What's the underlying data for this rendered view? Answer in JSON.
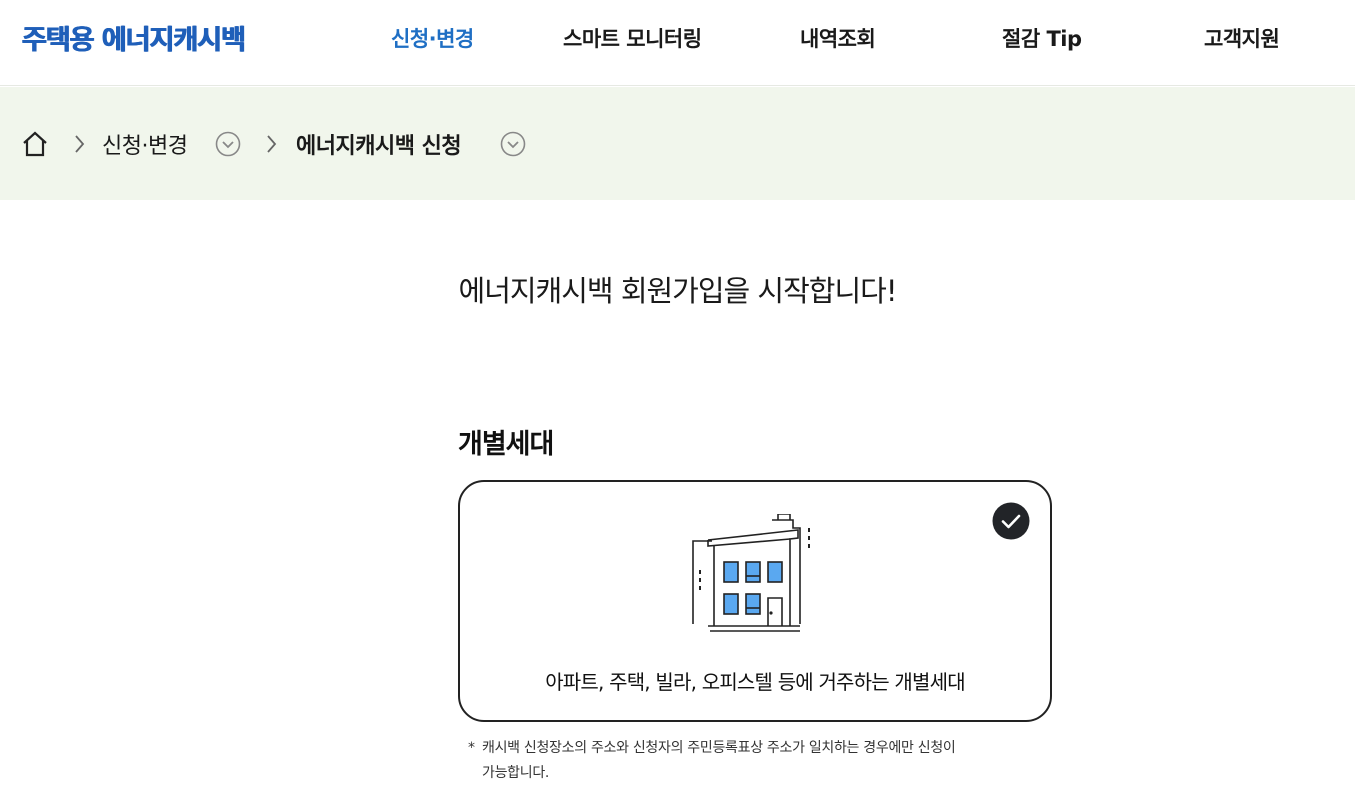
{
  "header": {
    "logo": "주택용 에너지캐시백",
    "nav": [
      {
        "label": "신청·변경",
        "active": true
      },
      {
        "label": "스마트 모니터링",
        "active": false
      },
      {
        "label": "내역조회",
        "active": false
      },
      {
        "label": "절감 Tip",
        "active": false
      },
      {
        "label": "고객지원",
        "active": false
      }
    ]
  },
  "breadcrumb": {
    "home_icon": "home-icon",
    "items": [
      {
        "label": "신청·변경"
      },
      {
        "label": "에너지캐시백 신청"
      }
    ]
  },
  "main": {
    "title": "에너지캐시백 회원가입을 시작합니다!",
    "section_title": "개별세대",
    "card": {
      "selected": true,
      "icon": "apartment-building-icon",
      "description": "아파트, 주택, 빌라, 오피스텔 등에 거주하는 개별세대"
    },
    "note": {
      "marker": "*",
      "line1": "캐시백 신청장소의 주소와 신청자의 주민등록표상 주소가 일치하는 경우에만 신청이",
      "line2": "가능합니다."
    }
  },
  "colors": {
    "brand": "#1f5fb9",
    "nav_active": "#1f6fc4",
    "breadcrumb_bg": "#f1f6ec",
    "window_blue": "#5aa8f0",
    "check_bg": "#222428"
  }
}
